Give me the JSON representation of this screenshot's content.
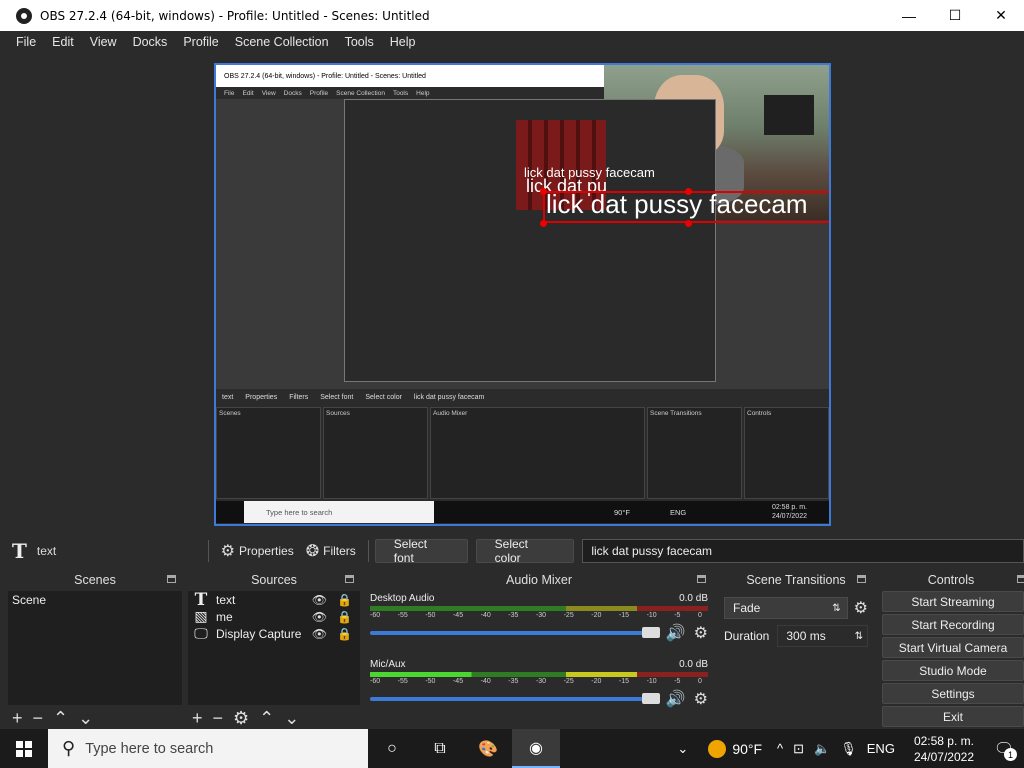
{
  "window": {
    "title": "OBS 27.2.4 (64-bit, windows) - Profile: Untitled - Scenes: Untitled",
    "minimize": "—",
    "maximize": "☐",
    "close": "✕"
  },
  "menu": [
    "File",
    "Edit",
    "View",
    "Docks",
    "Profile",
    "Scene Collection",
    "Tools",
    "Help"
  ],
  "preview": {
    "overlay_text": "lick dat pussy facecam",
    "echo_text_1": "lick dat pussy facecam",
    "echo_text_2": "lick dat pu",
    "nested": {
      "title": "OBS 27.2.4 (64-bit, windows) - Profile: Untitled - Scenes: Untitled",
      "menu": [
        "File",
        "Edit",
        "View",
        "Docks",
        "Profile",
        "Scene Collection",
        "Tools",
        "Help"
      ],
      "toolbar": {
        "source": "text",
        "properties": "Properties",
        "filters": "Filters",
        "select_font": "Select font",
        "select_color": "Select color",
        "text_value": "lick dat pussy facecam"
      },
      "panels": {
        "scenes": "Scenes",
        "sources": "Sources",
        "mixer": "Audio Mixer",
        "transitions": "Scene Transitions",
        "controls": "Controls"
      },
      "search": "Type here to search",
      "time": "02:58 p. m.",
      "date": "24/07/2022",
      "temp": "90°F",
      "lang": "ENG"
    }
  },
  "source_toolbar": {
    "source_name": "text",
    "properties": "Properties",
    "filters": "Filters",
    "select_font": "Select font",
    "select_color": "Select color",
    "text_value": "lick dat pussy facecam"
  },
  "scenes": {
    "title": "Scenes",
    "items": [
      "Scene"
    ]
  },
  "sources": {
    "title": "Sources",
    "items": [
      {
        "name": "text",
        "icon": "text-icon"
      },
      {
        "name": "me",
        "icon": "image-icon"
      },
      {
        "name": "Display Capture",
        "icon": "monitor-icon"
      }
    ]
  },
  "mixer": {
    "title": "Audio Mixer",
    "scale": [
      "-60",
      "-55",
      "-50",
      "-45",
      "-40",
      "-35",
      "-30",
      "-25",
      "-20",
      "-15",
      "-10",
      "-5",
      "0"
    ],
    "tracks": [
      {
        "name": "Desktop Audio",
        "level": "0.0 dB",
        "volume": 1.0
      },
      {
        "name": "Mic/Aux",
        "level": "0.0 dB",
        "volume": 1.0
      }
    ]
  },
  "transitions": {
    "title": "Scene Transitions",
    "selected": "Fade",
    "duration_label": "Duration",
    "duration_value": "300 ms"
  },
  "controls": {
    "title": "Controls",
    "buttons": [
      "Start Streaming",
      "Start Recording",
      "Start Virtual Camera",
      "Studio Mode",
      "Settings",
      "Exit"
    ]
  },
  "taskbar": {
    "search_placeholder": "Type here to search",
    "temperature": "90°F",
    "language": "ENG",
    "time": "02:58 p. m.",
    "date": "24/07/2022",
    "notification_count": "1"
  },
  "colors": {
    "accent": "#3d7ad8",
    "panel_bg": "#2b2b2b",
    "list_bg": "#1f1f1f",
    "selection_box": "#dd0000"
  }
}
